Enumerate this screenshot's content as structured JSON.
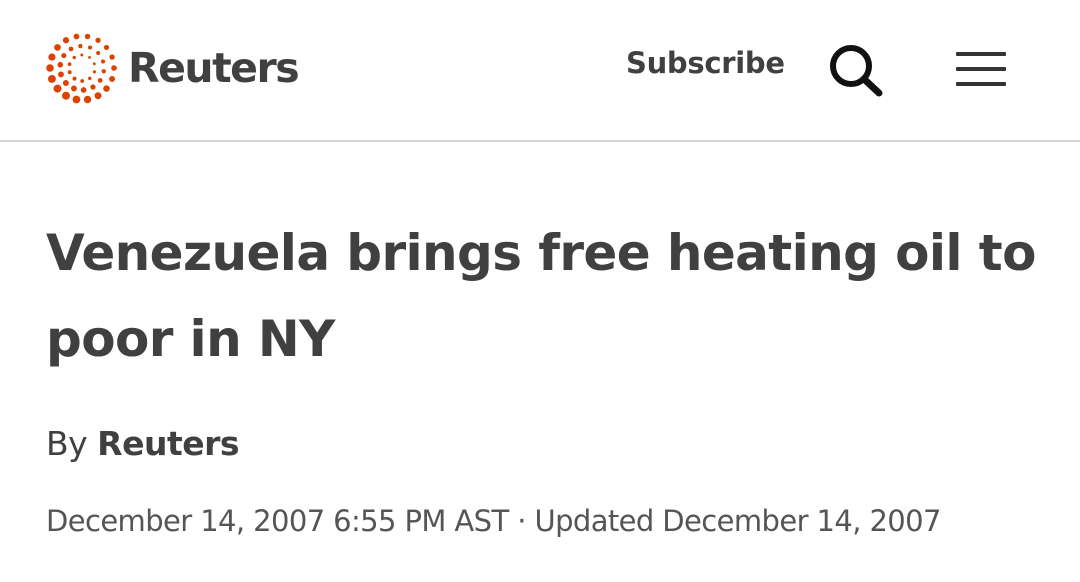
{
  "header": {
    "brand": "Reuters",
    "subscribe_label": "Subscribe",
    "search_icon": "search-icon",
    "menu_icon": "hamburger-menu-icon",
    "brand_color": "#dc4300"
  },
  "article": {
    "headline": "Venezuela brings free heating oil to poor in NY",
    "byline_prefix": "By",
    "author": "Reuters",
    "published": "December 14, 2007 6:55 PM AST",
    "separator": " · ",
    "updated": "Updated December 14, 2007"
  }
}
